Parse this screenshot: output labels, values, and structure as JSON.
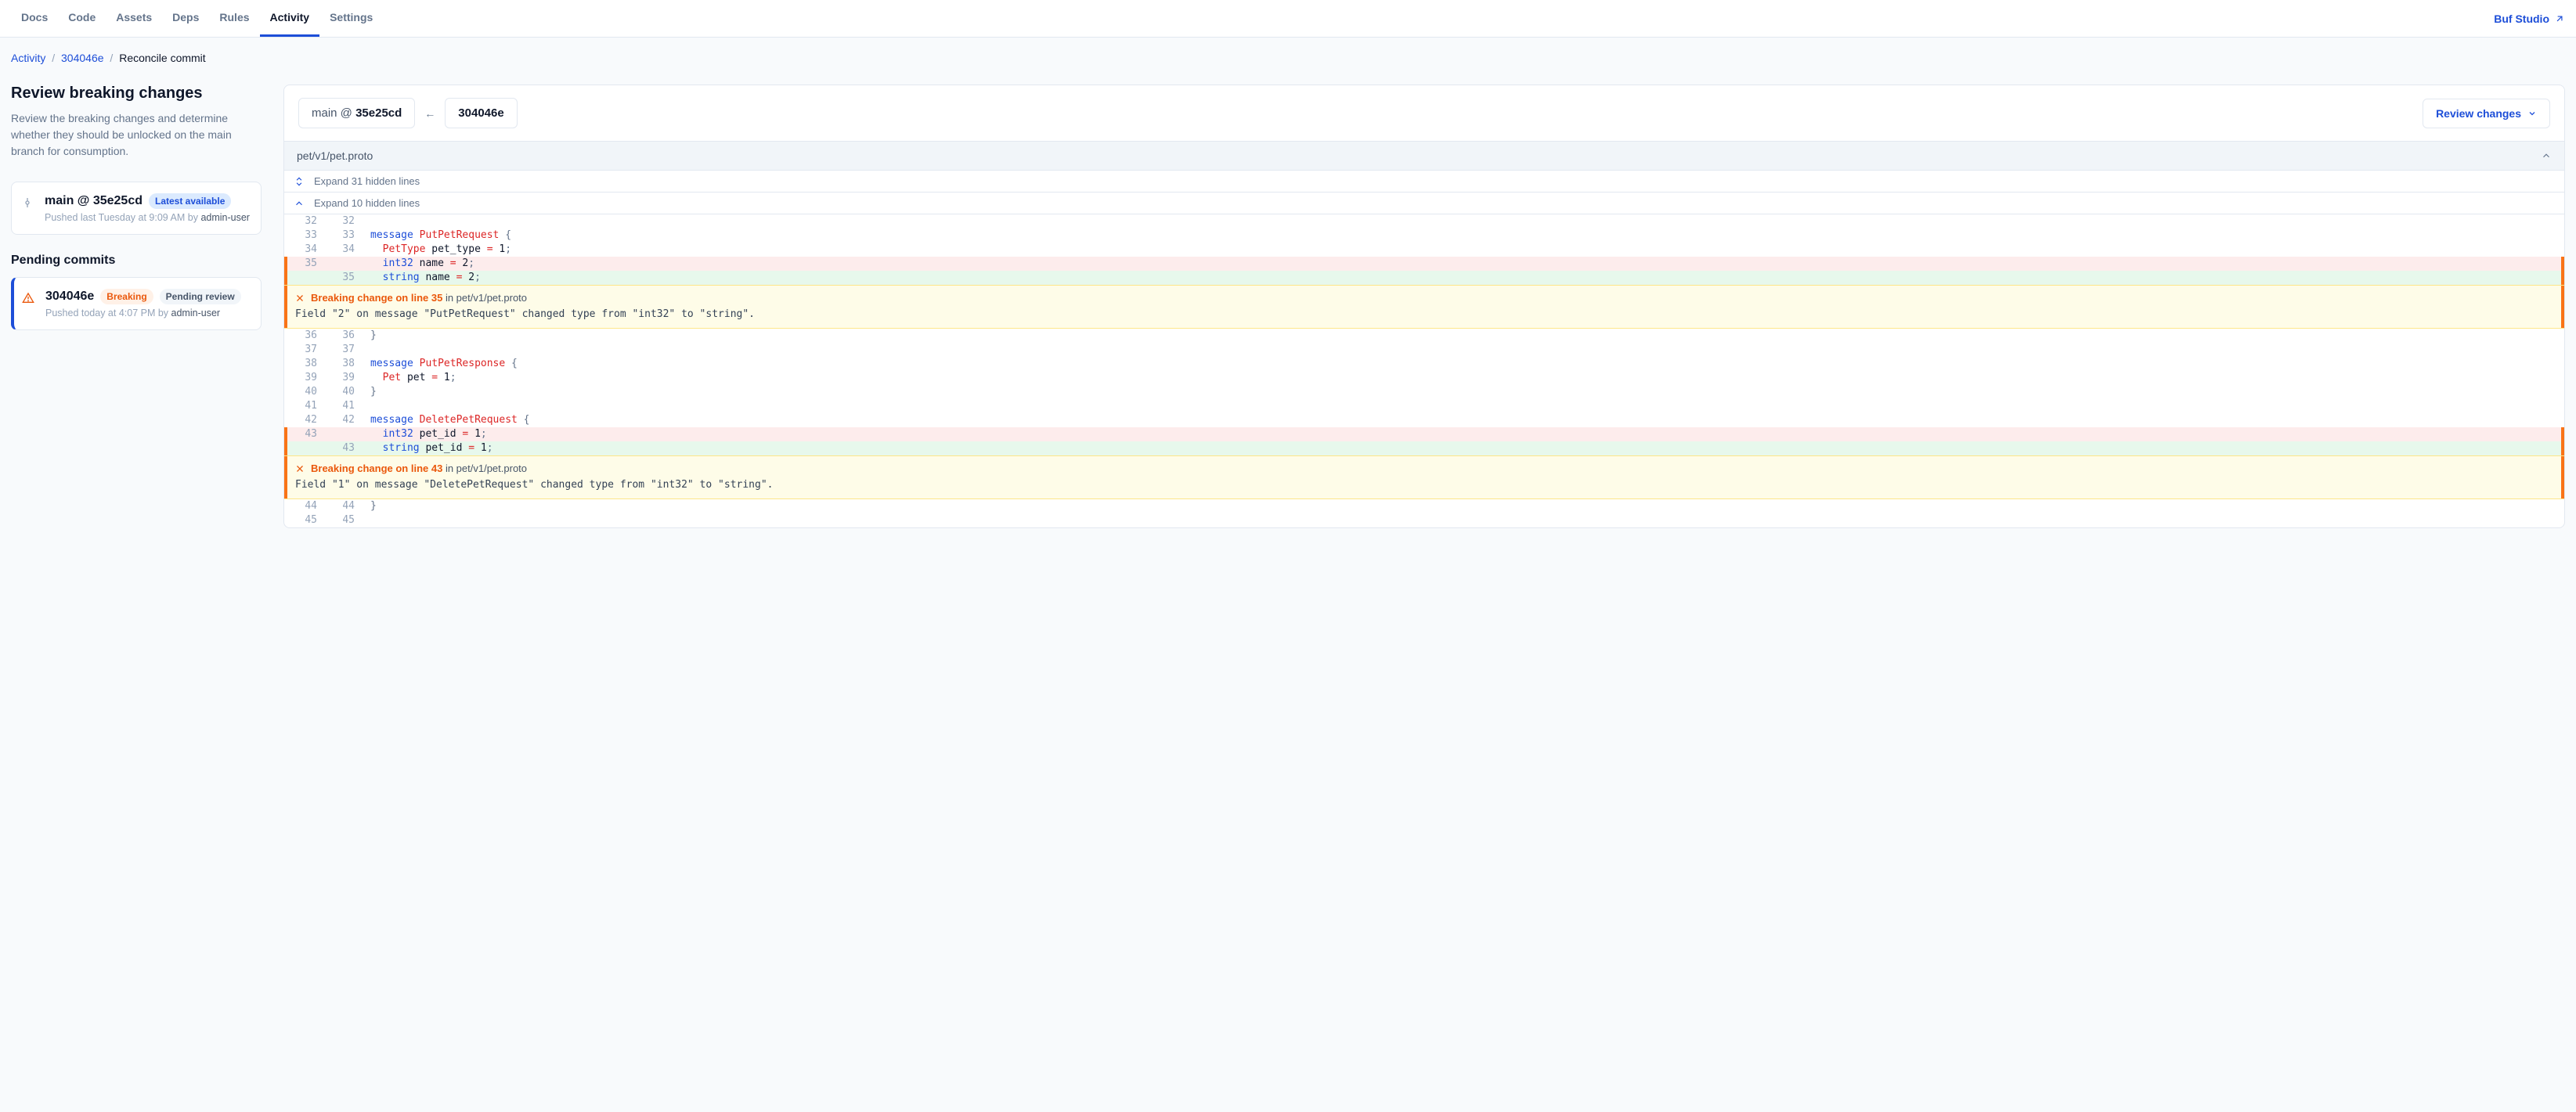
{
  "nav": {
    "tabs": [
      "Docs",
      "Code",
      "Assets",
      "Deps",
      "Rules",
      "Activity",
      "Settings"
    ],
    "active": "Activity",
    "right_link": "Buf Studio"
  },
  "breadcrumbs": {
    "root": "Activity",
    "commit": "304046e",
    "current": "Reconcile commit"
  },
  "sidebar": {
    "title": "Review breaking changes",
    "subtitle": "Review the breaking changes and determine whether they should be unlocked on the main branch for consumption.",
    "latest_card": {
      "title": "main @ 35e25cd",
      "badge": "Latest available",
      "meta_prefix": "Pushed last Tuesday at 9:09 AM by ",
      "meta_user": "admin-user"
    },
    "pending_heading": "Pending commits",
    "pending_card": {
      "title": "304046e",
      "badge_breaking": "Breaking",
      "badge_pending": "Pending review",
      "meta_prefix": "Pushed today at 4:07 PM by ",
      "meta_user": "admin-user"
    }
  },
  "main_header": {
    "left_pill_branch": "main @ ",
    "left_pill_sha": "35e25cd",
    "right_pill": "304046e",
    "review_button": "Review changes"
  },
  "file": {
    "path": "pet/v1/pet.proto",
    "expand1": "Expand 31 hidden lines",
    "expand2": "Expand 10 hidden lines"
  },
  "diff_lines": [
    {
      "old": "32",
      "new": "32",
      "kind": "ctx",
      "tokens": []
    },
    {
      "old": "33",
      "new": "33",
      "kind": "ctx",
      "tokens": [
        [
          "kw",
          "message "
        ],
        [
          "type",
          "PutPetRequest"
        ],
        [
          "punc",
          " {"
        ]
      ]
    },
    {
      "old": "34",
      "new": "34",
      "kind": "ctx",
      "tokens": [
        [
          "plain",
          "  "
        ],
        [
          "type",
          "PetType"
        ],
        [
          "name",
          " pet_type "
        ],
        [
          "op",
          "="
        ],
        [
          "num",
          " 1"
        ],
        [
          "punc",
          ";"
        ]
      ]
    },
    {
      "old": "35",
      "new": "",
      "kind": "removed",
      "tokens": [
        [
          "plain",
          "  "
        ],
        [
          "ty2",
          "int32"
        ],
        [
          "name",
          " name "
        ],
        [
          "op",
          "="
        ],
        [
          "num",
          " 2"
        ],
        [
          "punc",
          ";"
        ]
      ]
    },
    {
      "old": "",
      "new": "35",
      "kind": "added",
      "tokens": [
        [
          "plain",
          "  "
        ],
        [
          "ty2",
          "string"
        ],
        [
          "name",
          " name "
        ],
        [
          "op",
          "="
        ],
        [
          "num",
          " 2"
        ],
        [
          "punc",
          ";"
        ]
      ]
    }
  ],
  "alert1": {
    "title": "Breaking change on line 35",
    "in_text": " in pet/v1/pet.proto",
    "msg": "Field \"2\" on message \"PutPetRequest\" changed type from \"int32\" to \"string\"."
  },
  "diff_lines2": [
    {
      "old": "36",
      "new": "36",
      "kind": "ctx",
      "tokens": [
        [
          "punc",
          "}"
        ]
      ]
    },
    {
      "old": "37",
      "new": "37",
      "kind": "ctx",
      "tokens": []
    },
    {
      "old": "38",
      "new": "38",
      "kind": "ctx",
      "tokens": [
        [
          "kw",
          "message "
        ],
        [
          "type",
          "PutPetResponse"
        ],
        [
          "punc",
          " {"
        ]
      ]
    },
    {
      "old": "39",
      "new": "39",
      "kind": "ctx",
      "tokens": [
        [
          "plain",
          "  "
        ],
        [
          "type",
          "Pet"
        ],
        [
          "name",
          " pet "
        ],
        [
          "op",
          "="
        ],
        [
          "num",
          " 1"
        ],
        [
          "punc",
          ";"
        ]
      ]
    },
    {
      "old": "40",
      "new": "40",
      "kind": "ctx",
      "tokens": [
        [
          "punc",
          "}"
        ]
      ]
    },
    {
      "old": "41",
      "new": "41",
      "kind": "ctx",
      "tokens": []
    },
    {
      "old": "42",
      "new": "42",
      "kind": "ctx",
      "tokens": [
        [
          "kw",
          "message "
        ],
        [
          "type",
          "DeletePetRequest"
        ],
        [
          "punc",
          " {"
        ]
      ]
    },
    {
      "old": "43",
      "new": "",
      "kind": "removed",
      "tokens": [
        [
          "plain",
          "  "
        ],
        [
          "ty2",
          "int32"
        ],
        [
          "name",
          " pet_id "
        ],
        [
          "op",
          "="
        ],
        [
          "num",
          " 1"
        ],
        [
          "punc",
          ";"
        ]
      ]
    },
    {
      "old": "",
      "new": "43",
      "kind": "added",
      "tokens": [
        [
          "plain",
          "  "
        ],
        [
          "ty2",
          "string"
        ],
        [
          "name",
          " pet_id "
        ],
        [
          "op",
          "="
        ],
        [
          "num",
          " 1"
        ],
        [
          "punc",
          ";"
        ]
      ]
    }
  ],
  "alert2": {
    "title": "Breaking change on line 43",
    "in_text": " in pet/v1/pet.proto",
    "msg": "Field \"1\" on message \"DeletePetRequest\" changed type from \"int32\" to \"string\"."
  },
  "diff_lines3": [
    {
      "old": "44",
      "new": "44",
      "kind": "ctx",
      "tokens": [
        [
          "punc",
          "}"
        ]
      ]
    },
    {
      "old": "45",
      "new": "45",
      "kind": "ctx",
      "tokens": []
    }
  ]
}
